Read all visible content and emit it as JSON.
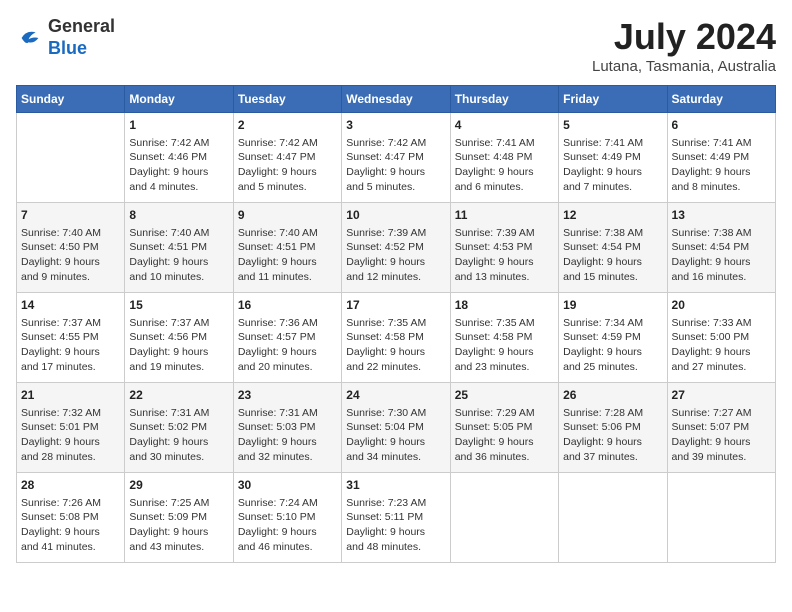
{
  "header": {
    "logo_line1": "General",
    "logo_line2": "Blue",
    "month_title": "July 2024",
    "location": "Lutana, Tasmania, Australia"
  },
  "days_of_week": [
    "Sunday",
    "Monday",
    "Tuesday",
    "Wednesday",
    "Thursday",
    "Friday",
    "Saturday"
  ],
  "weeks": [
    [
      {
        "day": "",
        "info": ""
      },
      {
        "day": "1",
        "info": "Sunrise: 7:42 AM\nSunset: 4:46 PM\nDaylight: 9 hours\nand 4 minutes."
      },
      {
        "day": "2",
        "info": "Sunrise: 7:42 AM\nSunset: 4:47 PM\nDaylight: 9 hours\nand 5 minutes."
      },
      {
        "day": "3",
        "info": "Sunrise: 7:42 AM\nSunset: 4:47 PM\nDaylight: 9 hours\nand 5 minutes."
      },
      {
        "day": "4",
        "info": "Sunrise: 7:41 AM\nSunset: 4:48 PM\nDaylight: 9 hours\nand 6 minutes."
      },
      {
        "day": "5",
        "info": "Sunrise: 7:41 AM\nSunset: 4:49 PM\nDaylight: 9 hours\nand 7 minutes."
      },
      {
        "day": "6",
        "info": "Sunrise: 7:41 AM\nSunset: 4:49 PM\nDaylight: 9 hours\nand 8 minutes."
      }
    ],
    [
      {
        "day": "7",
        "info": "Sunrise: 7:40 AM\nSunset: 4:50 PM\nDaylight: 9 hours\nand 9 minutes."
      },
      {
        "day": "8",
        "info": "Sunrise: 7:40 AM\nSunset: 4:51 PM\nDaylight: 9 hours\nand 10 minutes."
      },
      {
        "day": "9",
        "info": "Sunrise: 7:40 AM\nSunset: 4:51 PM\nDaylight: 9 hours\nand 11 minutes."
      },
      {
        "day": "10",
        "info": "Sunrise: 7:39 AM\nSunset: 4:52 PM\nDaylight: 9 hours\nand 12 minutes."
      },
      {
        "day": "11",
        "info": "Sunrise: 7:39 AM\nSunset: 4:53 PM\nDaylight: 9 hours\nand 13 minutes."
      },
      {
        "day": "12",
        "info": "Sunrise: 7:38 AM\nSunset: 4:54 PM\nDaylight: 9 hours\nand 15 minutes."
      },
      {
        "day": "13",
        "info": "Sunrise: 7:38 AM\nSunset: 4:54 PM\nDaylight: 9 hours\nand 16 minutes."
      }
    ],
    [
      {
        "day": "14",
        "info": "Sunrise: 7:37 AM\nSunset: 4:55 PM\nDaylight: 9 hours\nand 17 minutes."
      },
      {
        "day": "15",
        "info": "Sunrise: 7:37 AM\nSunset: 4:56 PM\nDaylight: 9 hours\nand 19 minutes."
      },
      {
        "day": "16",
        "info": "Sunrise: 7:36 AM\nSunset: 4:57 PM\nDaylight: 9 hours\nand 20 minutes."
      },
      {
        "day": "17",
        "info": "Sunrise: 7:35 AM\nSunset: 4:58 PM\nDaylight: 9 hours\nand 22 minutes."
      },
      {
        "day": "18",
        "info": "Sunrise: 7:35 AM\nSunset: 4:58 PM\nDaylight: 9 hours\nand 23 minutes."
      },
      {
        "day": "19",
        "info": "Sunrise: 7:34 AM\nSunset: 4:59 PM\nDaylight: 9 hours\nand 25 minutes."
      },
      {
        "day": "20",
        "info": "Sunrise: 7:33 AM\nSunset: 5:00 PM\nDaylight: 9 hours\nand 27 minutes."
      }
    ],
    [
      {
        "day": "21",
        "info": "Sunrise: 7:32 AM\nSunset: 5:01 PM\nDaylight: 9 hours\nand 28 minutes."
      },
      {
        "day": "22",
        "info": "Sunrise: 7:31 AM\nSunset: 5:02 PM\nDaylight: 9 hours\nand 30 minutes."
      },
      {
        "day": "23",
        "info": "Sunrise: 7:31 AM\nSunset: 5:03 PM\nDaylight: 9 hours\nand 32 minutes."
      },
      {
        "day": "24",
        "info": "Sunrise: 7:30 AM\nSunset: 5:04 PM\nDaylight: 9 hours\nand 34 minutes."
      },
      {
        "day": "25",
        "info": "Sunrise: 7:29 AM\nSunset: 5:05 PM\nDaylight: 9 hours\nand 36 minutes."
      },
      {
        "day": "26",
        "info": "Sunrise: 7:28 AM\nSunset: 5:06 PM\nDaylight: 9 hours\nand 37 minutes."
      },
      {
        "day": "27",
        "info": "Sunrise: 7:27 AM\nSunset: 5:07 PM\nDaylight: 9 hours\nand 39 minutes."
      }
    ],
    [
      {
        "day": "28",
        "info": "Sunrise: 7:26 AM\nSunset: 5:08 PM\nDaylight: 9 hours\nand 41 minutes."
      },
      {
        "day": "29",
        "info": "Sunrise: 7:25 AM\nSunset: 5:09 PM\nDaylight: 9 hours\nand 43 minutes."
      },
      {
        "day": "30",
        "info": "Sunrise: 7:24 AM\nSunset: 5:10 PM\nDaylight: 9 hours\nand 46 minutes."
      },
      {
        "day": "31",
        "info": "Sunrise: 7:23 AM\nSunset: 5:11 PM\nDaylight: 9 hours\nand 48 minutes."
      },
      {
        "day": "",
        "info": ""
      },
      {
        "day": "",
        "info": ""
      },
      {
        "day": "",
        "info": ""
      }
    ]
  ]
}
